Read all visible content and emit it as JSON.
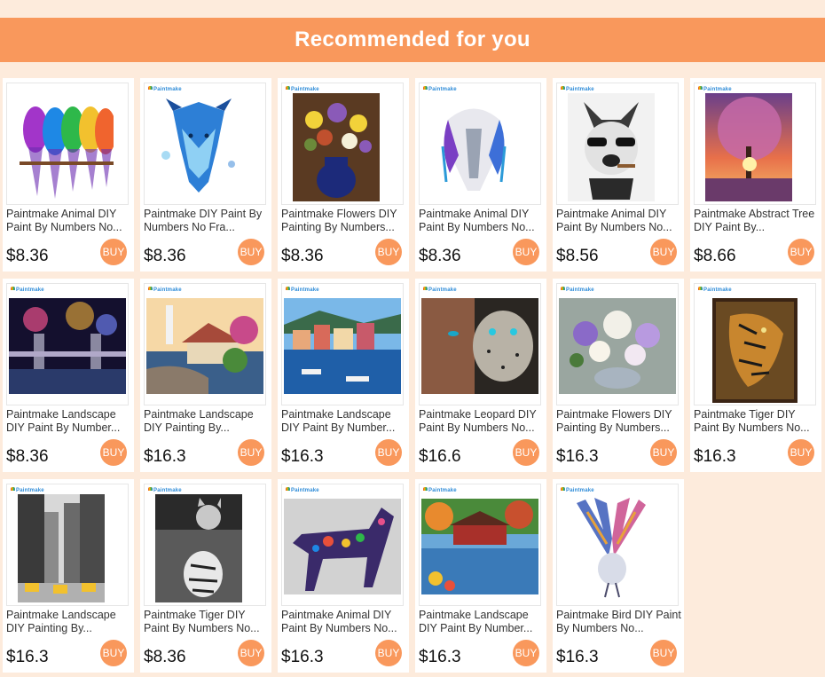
{
  "header": {
    "title": "Recommended for you"
  },
  "buy_label": "BUY",
  "brand_label": "Paintmake",
  "colors": {
    "accent": "#f9985c",
    "background": "#fdebdc"
  },
  "products": [
    {
      "title": "Paintmake Animal DIY Paint By Numbers No...",
      "price": "$8.36"
    },
    {
      "title": "Paintmake DIY Paint By Numbers No Fra...",
      "price": "$8.36"
    },
    {
      "title": "Paintmake Flowers DIY Painting By Numbers...",
      "price": "$8.36"
    },
    {
      "title": "Paintmake Animal DIY Paint By Numbers No...",
      "price": "$8.36"
    },
    {
      "title": "Paintmake Animal DIY Paint By Numbers No...",
      "price": "$8.56"
    },
    {
      "title": "Paintmake Abstract Tree DIY Paint By...",
      "price": "$8.66"
    },
    {
      "title": "Paintmake Landscape DIY Paint By Number...",
      "price": "$8.36"
    },
    {
      "title": "Paintmake Landscape DIY Painting By...",
      "price": "$16.3"
    },
    {
      "title": "Paintmake Landscape DIY Paint By Number...",
      "price": "$16.3"
    },
    {
      "title": "Paintmake Leopard DIY Paint By Numbers No...",
      "price": "$16.6"
    },
    {
      "title": "Paintmake Flowers DIY Painting By Numbers...",
      "price": "$16.3"
    },
    {
      "title": "Paintmake Tiger DIY Paint By Numbers No...",
      "price": "$16.3"
    },
    {
      "title": "Paintmake Landscape DIY Painting By...",
      "price": "$16.3"
    },
    {
      "title": "Paintmake Tiger DIY Paint By Numbers No...",
      "price": "$8.36"
    },
    {
      "title": "Paintmake Animal DIY Paint By Numbers No...",
      "price": "$16.3"
    },
    {
      "title": "Paintmake Landscape DIY Paint By Number...",
      "price": "$16.3"
    },
    {
      "title": "Paintmake Bird DIY Paint By Numbers No...",
      "price": "$16.3"
    }
  ]
}
